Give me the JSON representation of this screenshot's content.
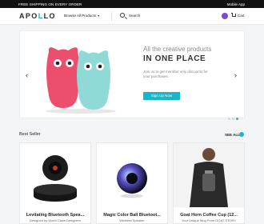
{
  "topbar": {
    "shipping": "FREE SHIPPING ON EVERY ORDER",
    "mobile_app": "Mobile App"
  },
  "nav": {
    "logo": "APOLLO",
    "browse": "Browse All Products",
    "search": "Search",
    "cart": "Cart"
  },
  "hero": {
    "tagline": "All the creative products",
    "title": "IN ONE PLACE",
    "description": "Join us to get member only discounts for your purchases.",
    "button": "Sign Up Now",
    "slide_count": 3,
    "active_slide": 3
  },
  "section": {
    "title": "Best Seller",
    "see_all": "SEE ALL"
  },
  "products": [
    {
      "name": "Levitating Bluetooth Spea...",
      "subtitle": "Designed by World Class Designers"
    },
    {
      "name": "Magic Color Ball Bluetoot...",
      "subtitle": "Wireless Speaker"
    },
    {
      "name": "Goat Horn Coffee Cup (12...",
      "subtitle": "Your Unique Mug From GOAT STORY"
    }
  ],
  "colors": {
    "accent": "#19b6c9",
    "topbar": "#111111",
    "background": "#f4f5f7"
  }
}
